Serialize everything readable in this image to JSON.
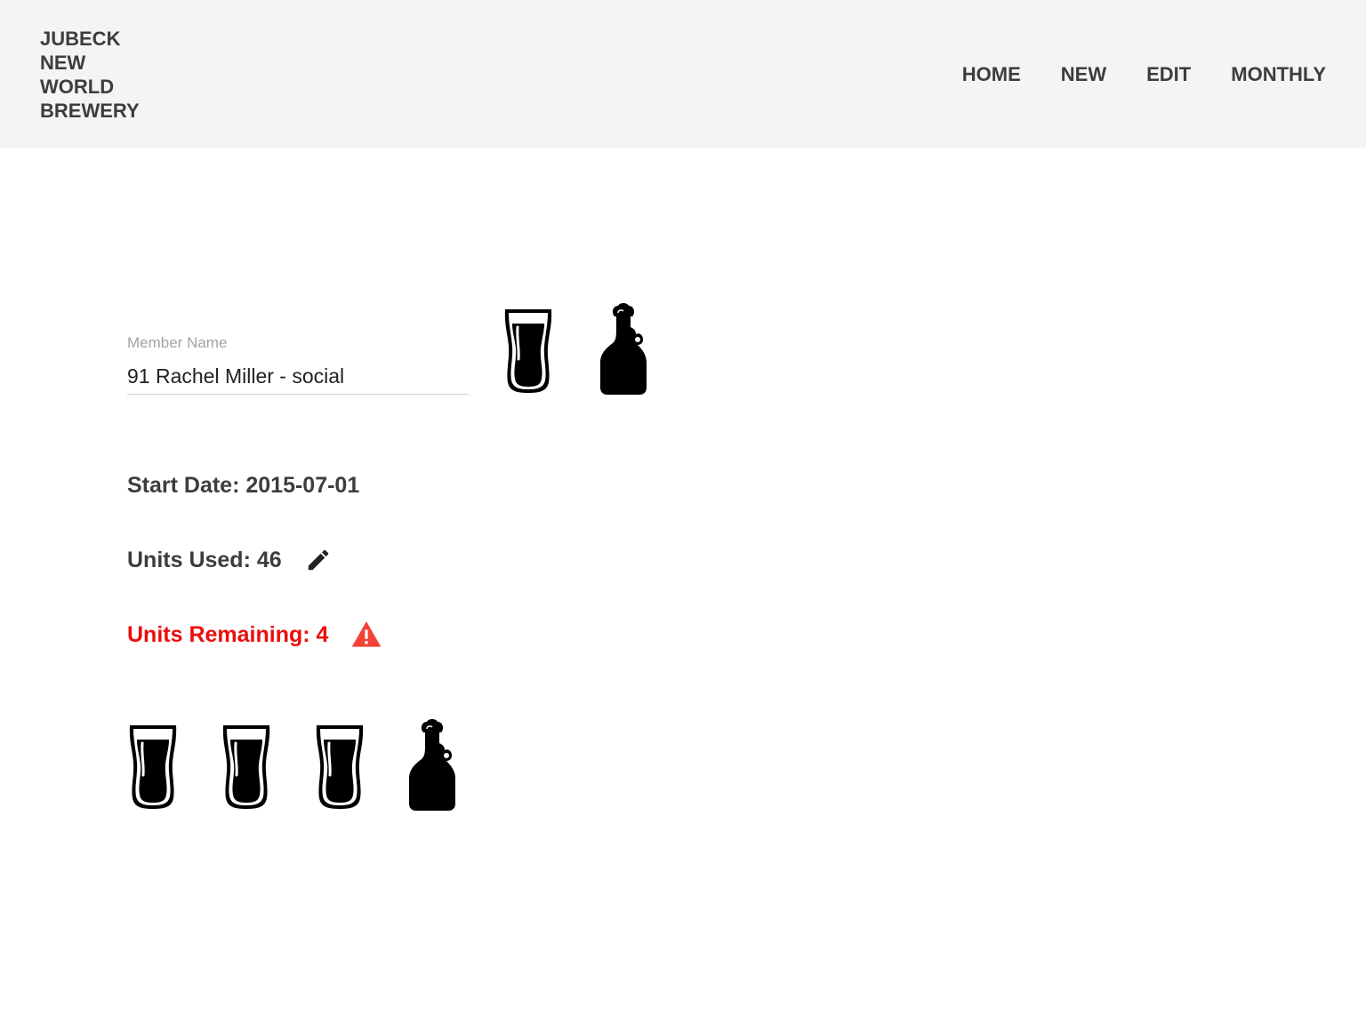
{
  "header": {
    "brand": "JUBECK\nNEW\nWORLD\nBREWERY",
    "nav": [
      {
        "label": "HOME"
      },
      {
        "label": "NEW"
      },
      {
        "label": "EDIT"
      },
      {
        "label": "MONTHLY"
      }
    ]
  },
  "member": {
    "label": "Member Name",
    "value": "91 Rachel Miller - social"
  },
  "quick_add_icons": [
    "pint-glass-icon",
    "growler-icon"
  ],
  "stats": {
    "start_date": "Start Date: 2015-07-01",
    "units_used": "Units Used: 46",
    "units_remaining": "Units Remaining: 4"
  },
  "remaining_icons": [
    "pint-glass-icon",
    "pint-glass-icon",
    "pint-glass-icon",
    "growler-icon"
  ],
  "colors": {
    "header_bg": "#f4f4f4",
    "text": "#3d3d3d",
    "warning": "#ec0d0d",
    "warning_icon": "#f44336"
  }
}
